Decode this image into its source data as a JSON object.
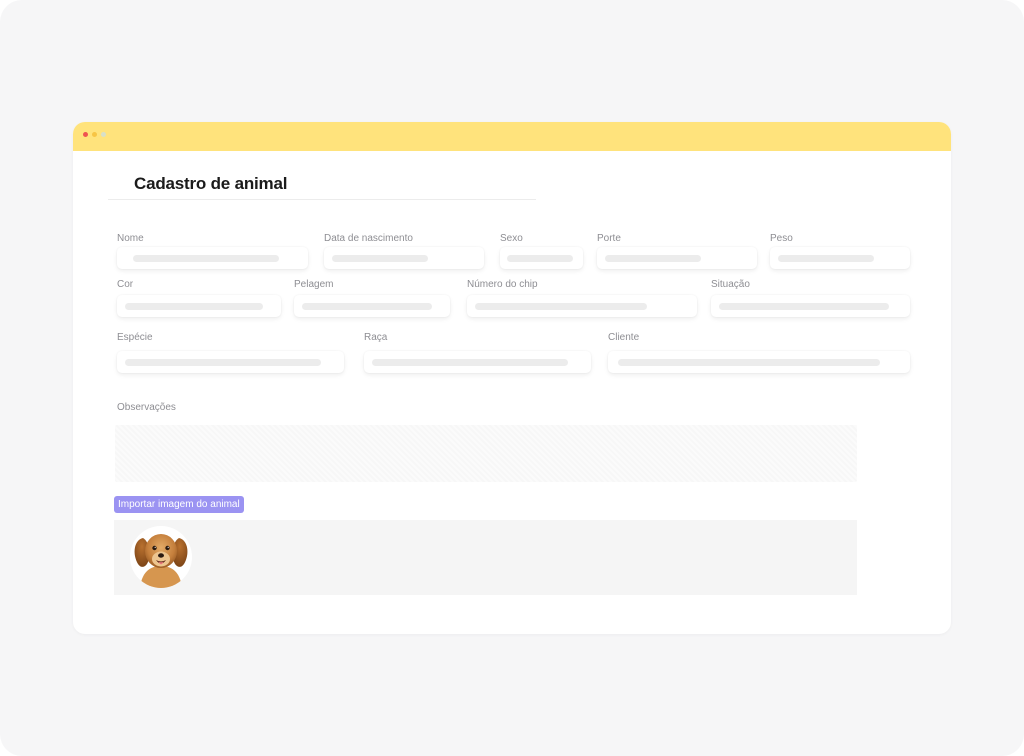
{
  "window": {
    "title_bar_color": "#ffe37c",
    "controls": [
      "close",
      "minimize",
      "maximize"
    ]
  },
  "page": {
    "title": "Cadastro de animal"
  },
  "form": {
    "fields": {
      "nome": {
        "label": "Nome",
        "value": ""
      },
      "data_nascimento": {
        "label": "Data de nascimento",
        "value": ""
      },
      "sexo": {
        "label": "Sexo",
        "value": ""
      },
      "porte": {
        "label": "Porte",
        "value": ""
      },
      "peso": {
        "label": "Peso",
        "value": ""
      },
      "cor": {
        "label": "Cor",
        "value": ""
      },
      "pelagem": {
        "label": "Pelagem",
        "value": ""
      },
      "numero_chip": {
        "label": "Número do chip",
        "value": ""
      },
      "situacao": {
        "label": "Situação",
        "value": ""
      },
      "especie": {
        "label": "Espécie",
        "value": ""
      },
      "raca": {
        "label": "Raça",
        "value": ""
      },
      "cliente": {
        "label": "Cliente",
        "value": ""
      },
      "observacoes": {
        "label": "Observações",
        "value": ""
      }
    },
    "import_button_label": "Importar imagem do animal",
    "accent_color": "#9b93f2",
    "image": {
      "icon": "dog-photo"
    }
  }
}
